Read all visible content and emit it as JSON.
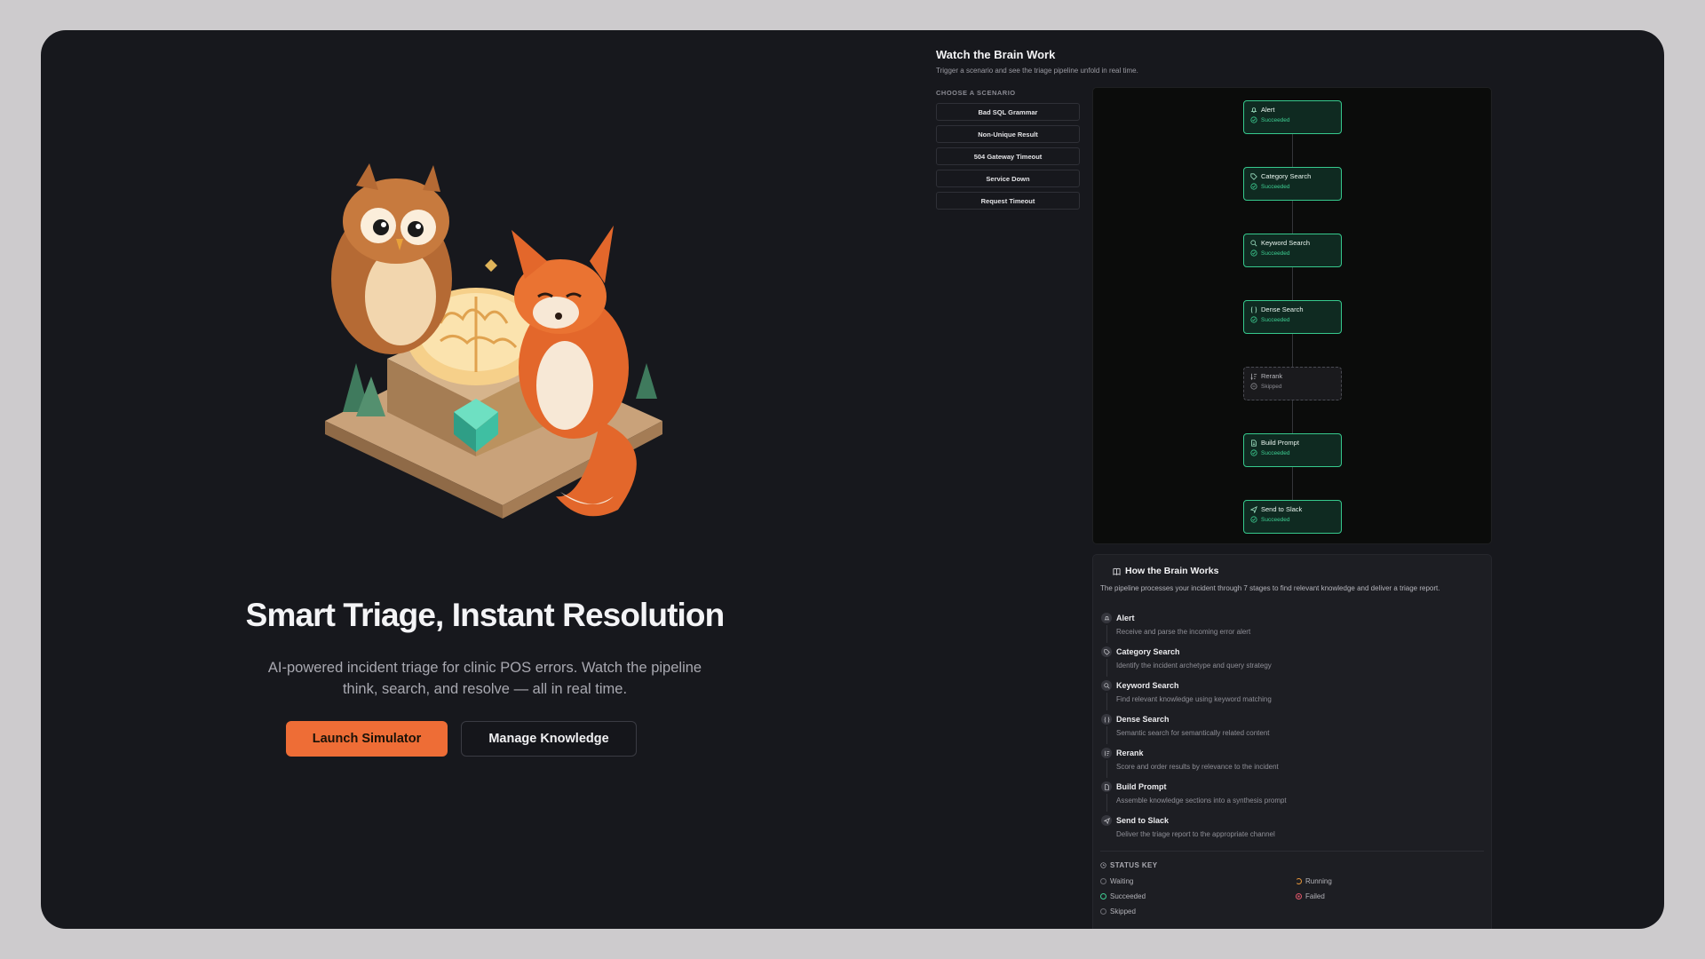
{
  "hero": {
    "title": "Smart Triage, Instant Resolution",
    "subtitle": "AI-powered incident triage for clinic POS errors. Watch the pipeline think, search, and resolve — all in real time.",
    "primary_button": "Launch Simulator",
    "secondary_button": "Manage Knowledge",
    "illustration": "owl-fox-brain-illustration"
  },
  "panel": {
    "title": "Watch the Brain Work",
    "subtitle": "Trigger a scenario and see the triage pipeline unfold in real time.",
    "choose_label": "CHOOSE A SCENARIO",
    "scenarios": [
      "Bad SQL Grammar",
      "Non-Unique Result",
      "504 Gateway Timeout",
      "Service Down",
      "Request Timeout"
    ]
  },
  "pipeline": [
    {
      "label": "Alert",
      "status": "Succeeded",
      "icon": "bell-icon"
    },
    {
      "label": "Category Search",
      "status": "Succeeded",
      "icon": "tag-icon"
    },
    {
      "label": "Keyword Search",
      "status": "Succeeded",
      "icon": "search-icon"
    },
    {
      "label": "Dense Search",
      "status": "Succeeded",
      "icon": "braces-icon"
    },
    {
      "label": "Rerank",
      "status": "Skipped",
      "icon": "sort-icon"
    },
    {
      "label": "Build Prompt",
      "status": "Succeeded",
      "icon": "document-icon"
    },
    {
      "label": "Send to Slack",
      "status": "Succeeded",
      "icon": "send-icon"
    }
  ],
  "how": {
    "title": "How the Brain Works",
    "description": "The pipeline processes your incident through 7 stages to find relevant knowledge and deliver a triage report.",
    "steps": [
      {
        "name": "Alert",
        "desc": "Receive and parse the incoming error alert"
      },
      {
        "name": "Category Search",
        "desc": "Identify the incident archetype and query strategy"
      },
      {
        "name": "Keyword Search",
        "desc": "Find relevant knowledge using keyword matching"
      },
      {
        "name": "Dense Search",
        "desc": "Semantic search for semantically related content"
      },
      {
        "name": "Rerank",
        "desc": "Score and order results by relevance to the incident"
      },
      {
        "name": "Build Prompt",
        "desc": "Assemble knowledge sections into a synthesis prompt"
      },
      {
        "name": "Send to Slack",
        "desc": "Deliver the triage report to the appropriate channel"
      }
    ],
    "status_key_title": "STATUS KEY",
    "status_key": {
      "waiting": "Waiting",
      "running": "Running",
      "succeeded": "Succeeded",
      "failed": "Failed",
      "skipped": "Skipped"
    }
  },
  "colors": {
    "accent": "#ee6d36",
    "success": "#36c98d",
    "background": "#17181d",
    "running": "#e8973a",
    "failed": "#e3586b"
  }
}
